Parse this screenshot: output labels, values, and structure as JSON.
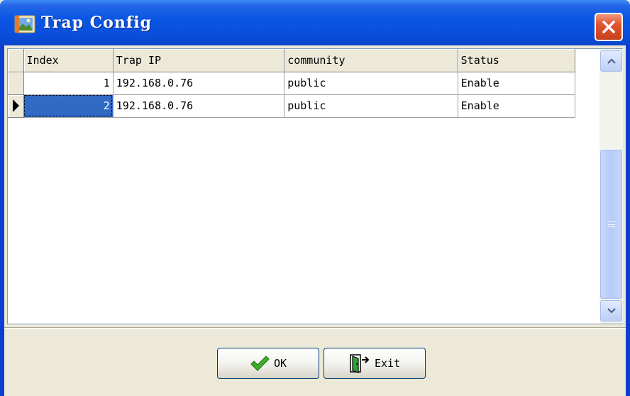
{
  "window": {
    "title": "Trap Config"
  },
  "grid": {
    "columns": [
      "Index",
      "Trap IP",
      "community",
      "Status"
    ],
    "rows": [
      {
        "index": "1",
        "trap_ip": "192.168.0.76",
        "community": "public",
        "status": "Enable"
      },
      {
        "index": "2",
        "trap_ip": "192.168.0.76",
        "community": "public",
        "status": "Enable"
      }
    ],
    "selected_row": 2
  },
  "buttons": {
    "ok_label": "OK",
    "exit_label": "Exit"
  },
  "colors": {
    "titlebar": "#0a56e4",
    "selection": "#316ac5",
    "close_button": "#e0532f"
  },
  "icons": [
    "app-icon",
    "close-icon",
    "row-indicator-arrow-icon",
    "scroll-up-icon",
    "scroll-down-icon",
    "checkmark-icon",
    "door-exit-icon"
  ]
}
